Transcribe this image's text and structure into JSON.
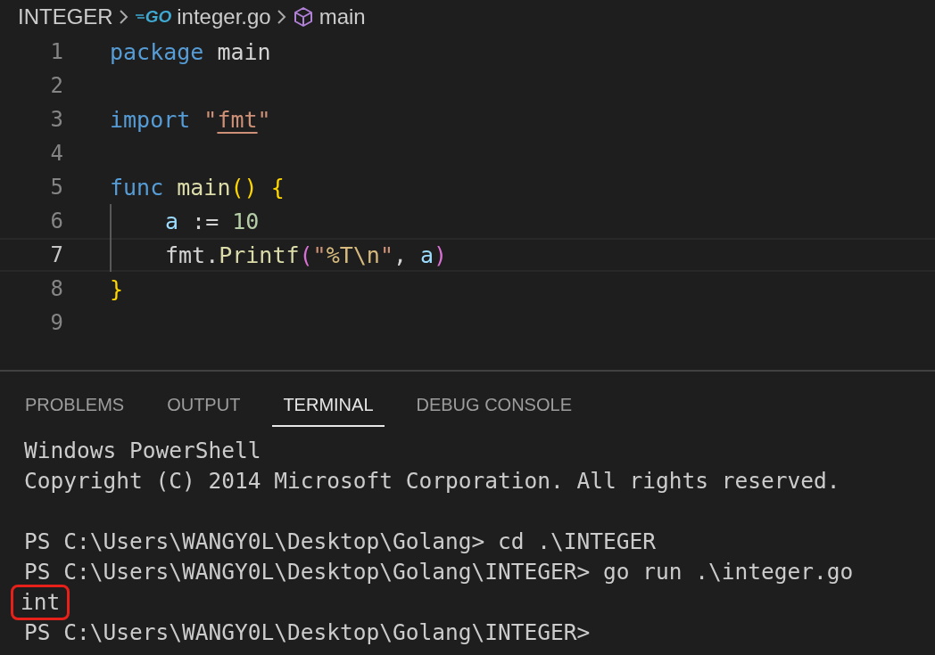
{
  "breadcrumbs": [
    {
      "kind": "folder",
      "label": "INTEGER"
    },
    {
      "kind": "go-file",
      "icon_label": "GO",
      "label": "integer.go"
    },
    {
      "kind": "symbol",
      "label": "main"
    }
  ],
  "editor": {
    "lines": [
      {
        "number": "1",
        "active": false,
        "tokens": [
          {
            "kind": "keyword",
            "text": "package"
          },
          {
            "kind": "plain",
            "text": " main"
          }
        ]
      },
      {
        "number": "2",
        "active": false
      },
      {
        "number": "3",
        "active": false,
        "tokens": [
          {
            "kind": "keyword",
            "text": "import "
          },
          {
            "kind": "string",
            "text": "\""
          },
          {
            "kind": "module",
            "text": "fmt"
          },
          {
            "kind": "string",
            "text": "\""
          }
        ]
      },
      {
        "number": "4",
        "active": false
      },
      {
        "number": "5",
        "active": false,
        "tokens": [
          {
            "kind": "keyword",
            "text": "func "
          },
          {
            "kind": "function",
            "text": "main"
          },
          {
            "kind": "bracket",
            "text": "() {"
          }
        ]
      },
      {
        "number": "6",
        "active": false,
        "indented": true,
        "tokens": [
          {
            "kind": "variable",
            "text": "a"
          },
          {
            "kind": "plain",
            "text": " := "
          },
          {
            "kind": "number",
            "text": "10"
          }
        ]
      },
      {
        "number": "7",
        "active": true,
        "indented": true,
        "tokens": [
          {
            "kind": "plain",
            "text": "fmt."
          },
          {
            "kind": "function",
            "text": "Printf"
          },
          {
            "kind": "bracket2",
            "text": "("
          },
          {
            "kind": "string",
            "text": "\""
          },
          {
            "kind": "escape",
            "text": "%T\\n"
          },
          {
            "kind": "string",
            "text": "\""
          },
          {
            "kind": "plain",
            "text": ", "
          },
          {
            "kind": "variable",
            "text": "a"
          },
          {
            "kind": "bracket2",
            "text": ")"
          }
        ]
      },
      {
        "number": "8",
        "active": false,
        "tokens": [
          {
            "kind": "bracket",
            "text": "}"
          }
        ]
      },
      {
        "number": "9",
        "active": false
      }
    ]
  },
  "panel": {
    "tabs": [
      {
        "label": "PROBLEMS",
        "selected": false
      },
      {
        "label": "OUTPUT",
        "selected": false
      },
      {
        "label": "TERMINAL",
        "selected": true
      },
      {
        "label": "DEBUG CONSOLE",
        "selected": false
      }
    ],
    "terminal_lines": [
      {
        "kind": "text",
        "text": "Windows PowerShell",
        "highlighted": false
      },
      {
        "kind": "text",
        "text": "Copyright (C) 2014 Microsoft Corporation. All rights reserved.",
        "highlighted": false
      },
      {
        "kind": "blank"
      },
      {
        "kind": "text",
        "text": "PS C:\\Users\\WANGY0L\\Desktop\\Golang> cd .\\INTEGER",
        "highlighted": false
      },
      {
        "kind": "text",
        "text": "PS C:\\Users\\WANGY0L\\Desktop\\Golang\\INTEGER> go run .\\integer.go",
        "highlighted": false
      },
      {
        "kind": "text",
        "text": "int",
        "highlighted": true
      },
      {
        "kind": "text",
        "text": "PS C:\\Users\\WANGY0L\\Desktop\\Golang\\INTEGER>",
        "highlighted": false
      }
    ]
  }
}
